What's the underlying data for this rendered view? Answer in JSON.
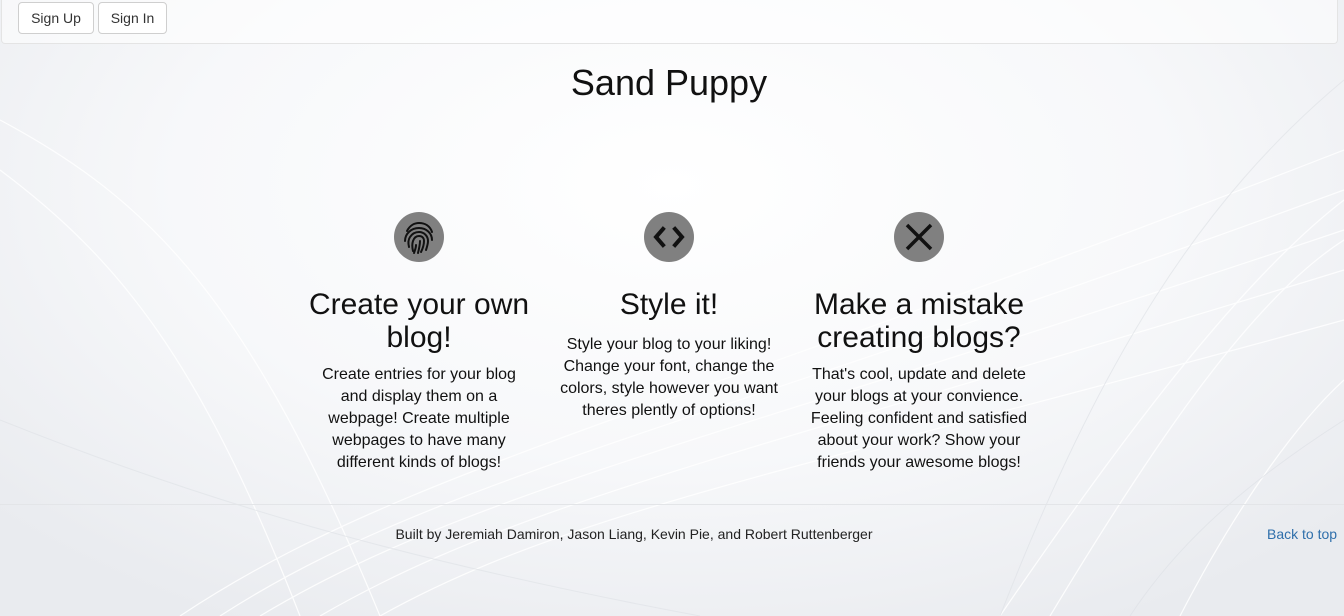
{
  "nav": {
    "sign_up": "Sign Up",
    "sign_in": "Sign In"
  },
  "site": {
    "title": "Sand Puppy"
  },
  "features": [
    {
      "icon": "fingerprint-icon",
      "heading": "Create your own blog!",
      "text": "Create entries for your blog and display them on a webpage! Create multiple webpages to have many different kinds of blogs!"
    },
    {
      "icon": "code-icon",
      "heading": "Style it!",
      "text": "Style your blog to your liking! Change your font, change the colors, style however you want theres plently of options!"
    },
    {
      "icon": "close-icon",
      "heading": "Make a mistake creating blogs?",
      "text": "That's cool, update and delete your blogs at your convience. Feeling confident and satisfied about your work? Show your friends your awesome blogs!"
    }
  ],
  "footer": {
    "credits": "Built by Jeremiah Damiron, Jason Liang, Kevin Pie, and Robert Ruttenberger",
    "back_to_top": "Back to top"
  },
  "colors": {
    "icon_circle": "#808080",
    "link": "#2f6fab",
    "text": "#111111"
  }
}
